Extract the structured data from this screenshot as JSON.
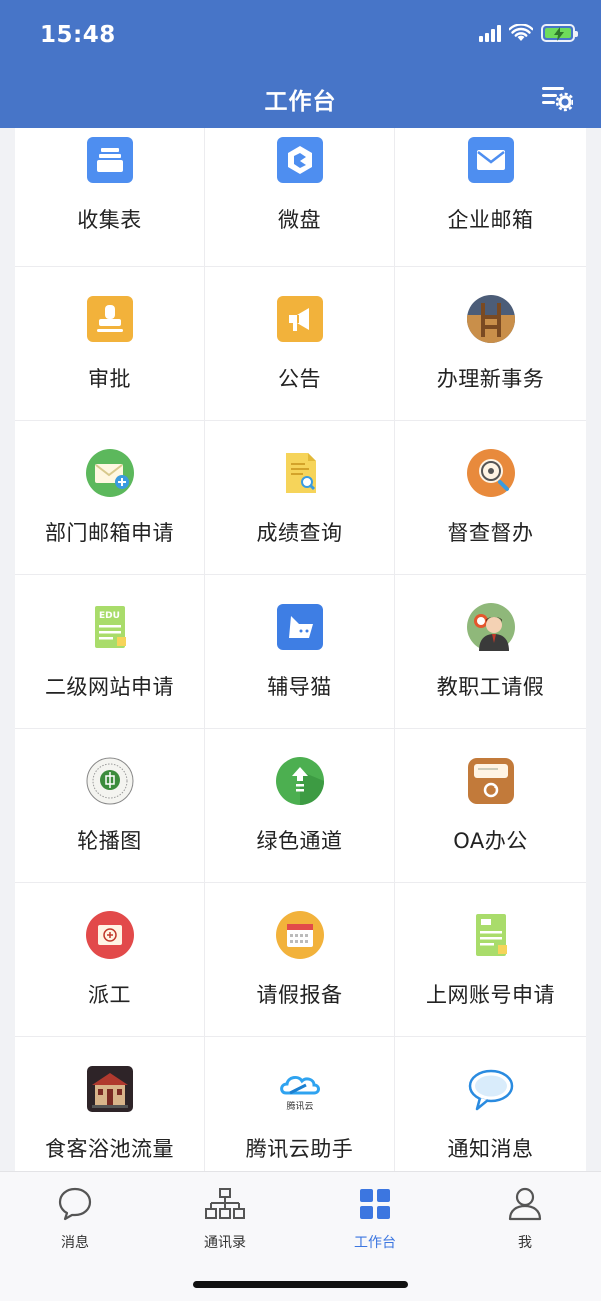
{
  "status_bar": {
    "time": "15:48"
  },
  "header": {
    "title": "工作台"
  },
  "apps": [
    {
      "label": "收集表",
      "icon": "collection-form-icon",
      "color": "#4e8ef0"
    },
    {
      "label": "微盘",
      "icon": "microdisk-icon",
      "color": "#4e8ef0"
    },
    {
      "label": "企业邮箱",
      "icon": "mail-icon",
      "color": "#4e8ef0"
    },
    {
      "label": "审批",
      "icon": "approval-stamp-icon",
      "color": "#f2b23b"
    },
    {
      "label": "公告",
      "icon": "announcement-icon",
      "color": "#f2b23b"
    },
    {
      "label": "办理新事务",
      "icon": "new-affairs-icon",
      "color": "#4c5d78"
    },
    {
      "label": "部门邮箱申请",
      "icon": "department-mail-icon",
      "color": "#5cb85c"
    },
    {
      "label": "成绩查询",
      "icon": "grade-query-icon",
      "color": "#f6d45a"
    },
    {
      "label": "督查督办",
      "icon": "supervision-icon",
      "color": "#e88a3c"
    },
    {
      "label": "二级网站申请",
      "icon": "edu-document-icon",
      "color": "#a9dc6b"
    },
    {
      "label": "辅导猫",
      "icon": "tutor-cat-icon",
      "color": "#4e8ef0"
    },
    {
      "label": "教职工请假",
      "icon": "staff-leave-icon",
      "color": "#6aa56a"
    },
    {
      "label": "轮播图",
      "icon": "school-seal-icon",
      "color": "#3c8c3c"
    },
    {
      "label": "绿色通道",
      "icon": "green-channel-icon",
      "color": "#4caf50"
    },
    {
      "label": "OA办公",
      "icon": "oa-office-icon",
      "color": "#c27a3a"
    },
    {
      "label": "派工",
      "icon": "dispatch-icon",
      "color": "#e24a4a"
    },
    {
      "label": "请假报备",
      "icon": "leave-calendar-icon",
      "color": "#f2b23b"
    },
    {
      "label": "上网账号申请",
      "icon": "internet-account-icon",
      "color": "#a9dc6b"
    },
    {
      "label": "食客浴池流量",
      "icon": "canteen-building-icon",
      "color": "#3a2d2d"
    },
    {
      "label": "腾讯云助手",
      "icon": "tencent-cloud-icon",
      "color": "#2fa3f0",
      "icon_text": "腾讯云"
    },
    {
      "label": "通知消息",
      "icon": "chat-bubble-icon",
      "color": "#2a8be0"
    }
  ],
  "tabbar": {
    "tabs": [
      {
        "label": "消息",
        "icon": "message-icon"
      },
      {
        "label": "通讯录",
        "icon": "org-chart-icon"
      },
      {
        "label": "工作台",
        "icon": "grid-apps-icon",
        "active": true
      },
      {
        "label": "我",
        "icon": "user-icon"
      }
    ]
  }
}
